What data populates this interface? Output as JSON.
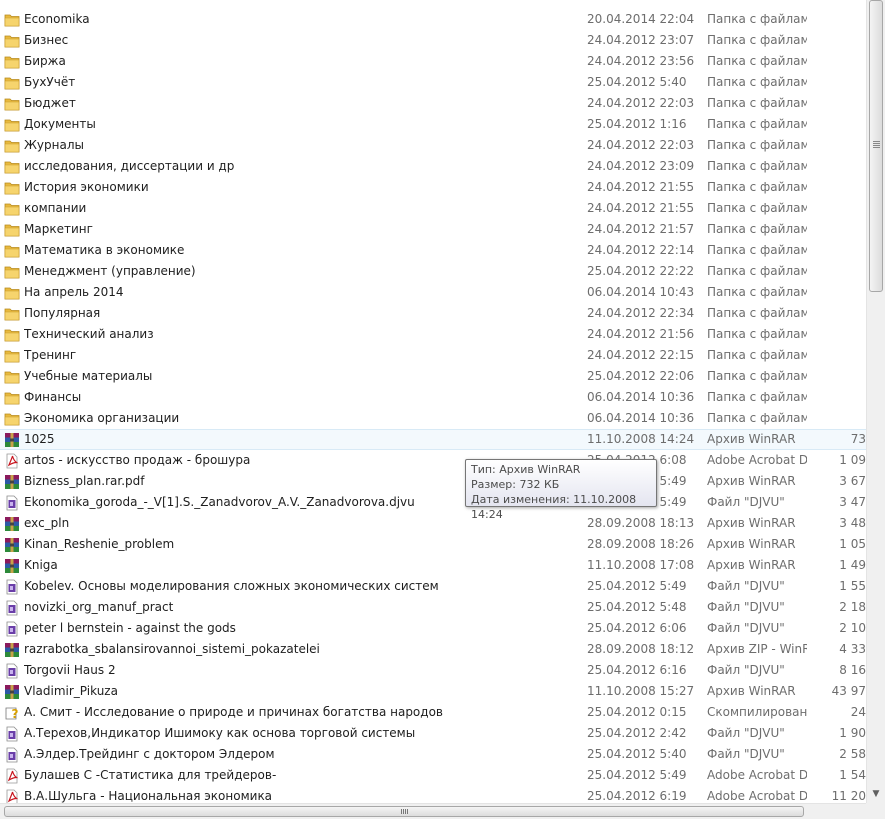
{
  "files": [
    {
      "name": "Economika",
      "date": "20.04.2014 22:04",
      "type": "Папка с файлами",
      "size": "",
      "icon": "folder"
    },
    {
      "name": "Бизнес",
      "date": "24.04.2012 23:07",
      "type": "Папка с файлами",
      "size": "",
      "icon": "folder"
    },
    {
      "name": "Биржа",
      "date": "24.04.2012 23:56",
      "type": "Папка с файлами",
      "size": "",
      "icon": "folder"
    },
    {
      "name": "БухУчёт",
      "date": "25.04.2012 5:40",
      "type": "Папка с файлами",
      "size": "",
      "icon": "folder"
    },
    {
      "name": "Бюджет",
      "date": "24.04.2012 22:03",
      "type": "Папка с файлами",
      "size": "",
      "icon": "folder"
    },
    {
      "name": "Документы",
      "date": "25.04.2012 1:16",
      "type": "Папка с файлами",
      "size": "",
      "icon": "folder"
    },
    {
      "name": "Журналы",
      "date": "24.04.2012 22:03",
      "type": "Папка с файлами",
      "size": "",
      "icon": "folder"
    },
    {
      "name": "исследования, диссертации и др",
      "date": "24.04.2012 23:09",
      "type": "Папка с файлами",
      "size": "",
      "icon": "folder"
    },
    {
      "name": "История экономики",
      "date": "24.04.2012 21:55",
      "type": "Папка с файлами",
      "size": "",
      "icon": "folder"
    },
    {
      "name": "компании",
      "date": "24.04.2012 21:55",
      "type": "Папка с файлами",
      "size": "",
      "icon": "folder"
    },
    {
      "name": "Маркетинг",
      "date": "24.04.2012 21:57",
      "type": "Папка с файлами",
      "size": "",
      "icon": "folder"
    },
    {
      "name": "Математика в экономике",
      "date": "24.04.2012 22:14",
      "type": "Папка с файлами",
      "size": "",
      "icon": "folder"
    },
    {
      "name": "Менеджмент (управление)",
      "date": "25.04.2012 22:22",
      "type": "Папка с файлами",
      "size": "",
      "icon": "folder"
    },
    {
      "name": "На апрель 2014",
      "date": "06.04.2014 10:43",
      "type": "Папка с файлами",
      "size": "",
      "icon": "folder"
    },
    {
      "name": "Популярная",
      "date": "24.04.2012 22:34",
      "type": "Папка с файлами",
      "size": "",
      "icon": "folder"
    },
    {
      "name": "Технический анализ",
      "date": "24.04.2012 21:56",
      "type": "Папка с файлами",
      "size": "",
      "icon": "folder"
    },
    {
      "name": "Тренинг",
      "date": "24.04.2012 22:15",
      "type": "Папка с файлами",
      "size": "",
      "icon": "folder"
    },
    {
      "name": "Учебные материалы",
      "date": "25.04.2012 22:06",
      "type": "Папка с файлами",
      "size": "",
      "icon": "folder"
    },
    {
      "name": "Финансы",
      "date": "06.04.2014 10:36",
      "type": "Папка с файлами",
      "size": "",
      "icon": "folder"
    },
    {
      "name": "Экономика организации",
      "date": "06.04.2014 10:36",
      "type": "Папка с файлами",
      "size": "",
      "icon": "folder"
    },
    {
      "name": "1025",
      "date": "11.10.2008 14:24",
      "type": "Архив WinRAR",
      "size": "73",
      "icon": "winrar"
    },
    {
      "name": "artos - искусство продаж - брошура",
      "date": "25.04.2012 6:08",
      "type": "Adobe Acrobat D...",
      "size": "1 09",
      "icon": "pdf"
    },
    {
      "name": "Bizness_plan.rar.pdf",
      "date": "25.04.2012 5:49",
      "type": "Архив WinRAR",
      "size": "3 67",
      "icon": "winrar"
    },
    {
      "name": "Ekonomika_goroda_-_V[1].S._Zanadvorov_A.V._Zanadvorova.djvu",
      "date": "25.04.2012 5:49",
      "type": "Файл \"DJVU\"",
      "size": "3 47",
      "icon": "djvu"
    },
    {
      "name": "exc_pln",
      "date": "28.09.2008 18:13",
      "type": "Архив WinRAR",
      "size": "3 48",
      "icon": "winrar"
    },
    {
      "name": "Kinan_Reshenie_problem",
      "date": "28.09.2008 18:26",
      "type": "Архив WinRAR",
      "size": "1 05",
      "icon": "winrar"
    },
    {
      "name": "Kniga",
      "date": "11.10.2008 17:08",
      "type": "Архив WinRAR",
      "size": "1 49",
      "icon": "winrar"
    },
    {
      "name": "Kobelev. Основы моделирования сложных экономических систем",
      "date": "25.04.2012 5:49",
      "type": "Файл \"DJVU\"",
      "size": "1 55",
      "icon": "djvu"
    },
    {
      "name": "novizki_org_manuf_pract",
      "date": "25.04.2012 5:48",
      "type": "Файл \"DJVU\"",
      "size": "2 18",
      "icon": "djvu"
    },
    {
      "name": "peter l bernstein - against the gods",
      "date": "25.04.2012 6:06",
      "type": "Файл \"DJVU\"",
      "size": "2 10",
      "icon": "djvu"
    },
    {
      "name": "razrabotka_sbalansirovannoi_sistemi_pokazatelei",
      "date": "28.09.2008 18:12",
      "type": "Архив ZIP - WinR...",
      "size": "4 33",
      "icon": "winrar"
    },
    {
      "name": "Torgovii Haus 2",
      "date": "25.04.2012 6:16",
      "type": "Файл \"DJVU\"",
      "size": "8 16",
      "icon": "djvu"
    },
    {
      "name": "Vladimir_Pikuza",
      "date": "11.10.2008 15:27",
      "type": "Архив WinRAR",
      "size": "43 97",
      "icon": "winrar"
    },
    {
      "name": "А. Смит - Исследование о природе и причинах богатства народов",
      "date": "25.04.2012 0:15",
      "type": "Скомпилирован...",
      "size": "24",
      "icon": "chm"
    },
    {
      "name": "А.Терехов,Индикатор Ишимоку как основа торговой системы",
      "date": "25.04.2012 2:42",
      "type": "Файл \"DJVU\"",
      "size": "1 90",
      "icon": "djvu"
    },
    {
      "name": "А.Элдер.Трейдинг с доктором Элдером",
      "date": "25.04.2012 5:40",
      "type": "Файл \"DJVU\"",
      "size": "2 58",
      "icon": "djvu"
    },
    {
      "name": "Булашев С -Статистика для трейдеров-",
      "date": "25.04.2012 5:49",
      "type": "Adobe Acrobat D...",
      "size": "1 54",
      "icon": "pdf"
    },
    {
      "name": "В.А.Шульга - Национальная экономика",
      "date": "25.04.2012 6:19",
      "type": "Adobe Acrobat D...",
      "size": "11 20",
      "icon": "pdf"
    }
  ],
  "tooltip": {
    "type_line": "Тип: Архив WinRAR",
    "size_line": "Размер: 732 КБ",
    "date_line": "Дата изменения: 11.10.2008 14:24"
  },
  "hovered_index": 20,
  "scroll": {
    "vertical_position": 0.0,
    "vertical_visible_fraction": 0.36,
    "horizontal_position": 0.0
  },
  "icons": {
    "folder": "folder-icon",
    "winrar": "winrar-archive-icon",
    "pdf": "pdf-icon",
    "djvu": "djvu-file-icon",
    "chm": "chm-help-file-icon"
  }
}
